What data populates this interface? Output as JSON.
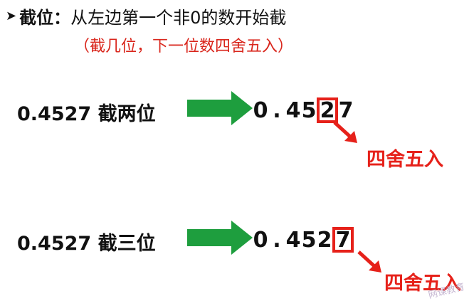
{
  "heading": {
    "bullet_icon": "triangle-bullet-icon",
    "term": "截位",
    "colon": "：",
    "description": "从左边第一个非0的数开始截"
  },
  "subnote": "（截几位，下一位数四舍五入）",
  "examples": [
    {
      "prompt": "0.4527 截两位",
      "result_digits": [
        "0",
        ".",
        "4",
        "5",
        "2",
        "7"
      ],
      "boxed_index": 4,
      "rounding_label": "四舍五入"
    },
    {
      "prompt": "0.4527 截三位",
      "result_digits": [
        "0",
        ".",
        "4",
        "5",
        "2",
        "7"
      ],
      "boxed_index": 5,
      "rounding_label": "四舍五入"
    }
  ],
  "colors": {
    "arrow_green": "#1e9e3e",
    "highlight_red": "#e6211a",
    "note_red": "#d9261c"
  },
  "watermark": "网课教育"
}
